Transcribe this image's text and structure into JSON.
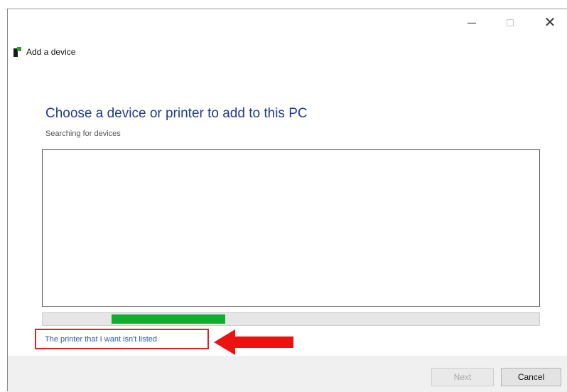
{
  "window": {
    "app_title": "Add a device",
    "controls": {
      "minimize_icon": "minimize-icon",
      "maximize_icon": "maximize-icon",
      "close_icon": "close-icon",
      "close_glyph": "✕"
    }
  },
  "main": {
    "heading": "Choose a device or printer to add to this PC",
    "status": "Searching for devices",
    "progress": 0.23,
    "link": "The printer that I want isn't listed"
  },
  "annotation": {
    "highlight_color": "#e0202a",
    "arrow_color": "#ee1111"
  },
  "footer": {
    "next_label": "Next",
    "cancel_label": "Cancel"
  },
  "colors": {
    "heading": "#1f3c8c",
    "progress_fill": "#0fae2f",
    "link": "#2a5db0"
  }
}
